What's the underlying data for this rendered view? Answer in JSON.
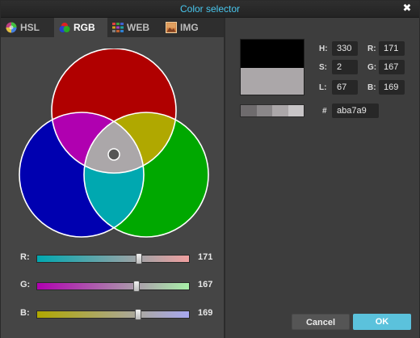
{
  "window": {
    "title": "Color selector",
    "close_glyph": "✖"
  },
  "tabs": [
    {
      "label": "HSL",
      "icon": "hsl-wheel-icon",
      "active": false
    },
    {
      "label": "RGB",
      "icon": "rgb-circles-icon",
      "active": true
    },
    {
      "label": "WEB",
      "icon": "web-palette-icon",
      "active": false
    },
    {
      "label": "IMG",
      "icon": "image-icon",
      "active": false
    }
  ],
  "colors": {
    "red_circle": "#b00000",
    "green_circle": "#00a800",
    "blue_circle": "#0000b0",
    "red_green_overlap": "#b0a800",
    "red_blue_overlap": "#b000b0",
    "green_blue_overlap": "#00a8b0",
    "center_overlap": "#aba7a9",
    "new_color": "#000000",
    "old_color": "#aba7a9",
    "ok_button": "#5bc2dc",
    "title_text": "#49c7ee"
  },
  "sliders": [
    {
      "label": "R:",
      "value": "171",
      "fraction": 0.67,
      "from": "#00a8b0",
      "to": "#f0a0a0"
    },
    {
      "label": "G:",
      "value": "167",
      "fraction": 0.655,
      "from": "#b000b0",
      "to": "#a8f0a8"
    },
    {
      "label": "B:",
      "value": "169",
      "fraction": 0.663,
      "from": "#b0a800",
      "to": "#a8a8f0"
    }
  ],
  "fields": {
    "h_label": "H:",
    "h_value": "330",
    "s_label": "S:",
    "s_value": "2",
    "l_label": "L:",
    "l_value": "67",
    "r_label": "R:",
    "r_value": "171",
    "g_label": "G:",
    "g_value": "167",
    "b_label": "B:",
    "b_value": "169",
    "hex_label": "#",
    "hex_value": "aba7a9"
  },
  "shades": [
    "#6e6b6d",
    "#8a8789",
    "#aba7a9",
    "#c8c5c7"
  ],
  "buttons": {
    "cancel": "Cancel",
    "ok": "OK"
  }
}
